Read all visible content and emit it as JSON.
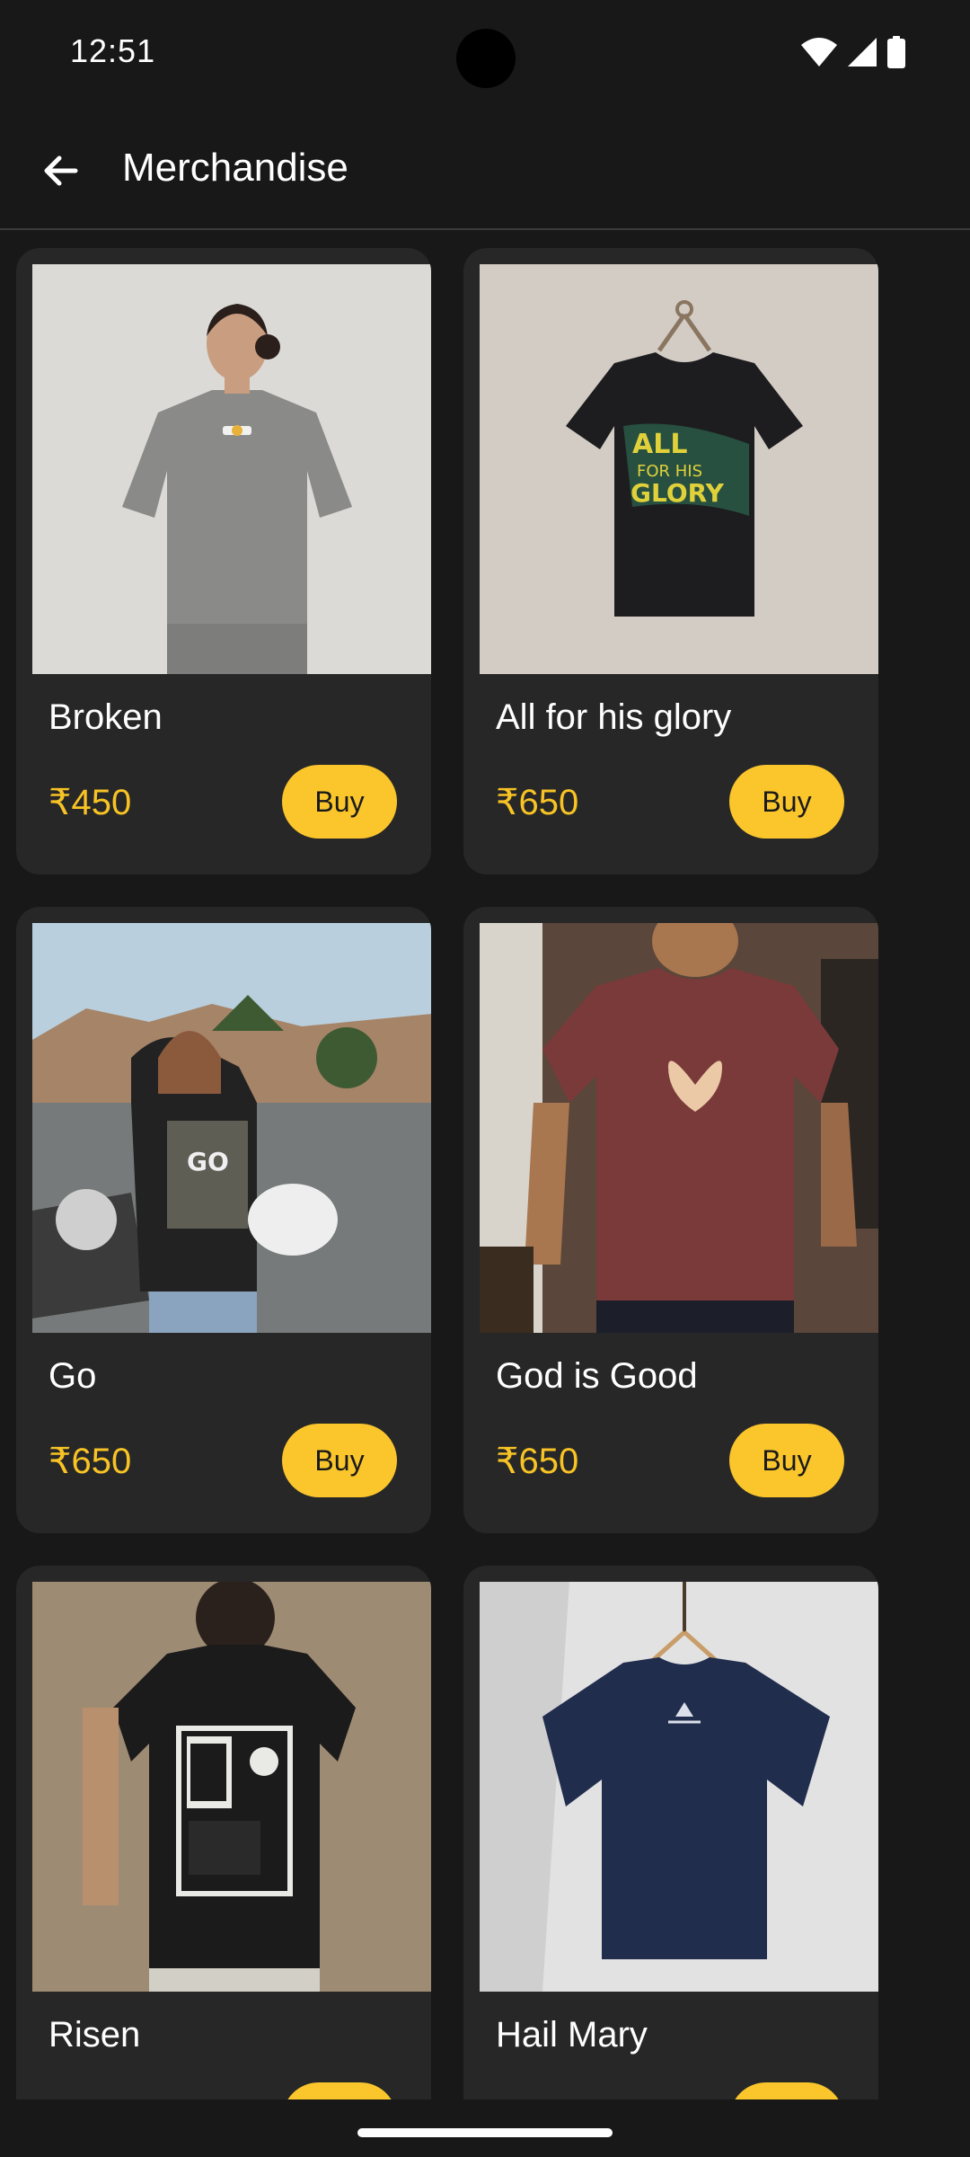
{
  "status_bar": {
    "time": "12:51",
    "icons": [
      "wifi-icon",
      "signal-icon",
      "battery-icon"
    ]
  },
  "app_bar": {
    "title": "Merchandise",
    "back_icon": "arrow-left-icon"
  },
  "colors": {
    "background": "#181818",
    "card": "#272727",
    "accent": "#fbc62c",
    "price": "#f7c325"
  },
  "products": [
    {
      "name": "Broken",
      "price": "₹450",
      "buy_label": "Buy"
    },
    {
      "name": "All for his glory",
      "price": "₹650",
      "buy_label": "Buy"
    },
    {
      "name": "Go",
      "price": "₹650",
      "buy_label": "Buy"
    },
    {
      "name": "God is Good",
      "price": "₹650",
      "buy_label": "Buy"
    },
    {
      "name": "Risen",
      "price": "",
      "buy_label": ""
    },
    {
      "name": "Hail Mary",
      "price": "",
      "buy_label": ""
    }
  ]
}
